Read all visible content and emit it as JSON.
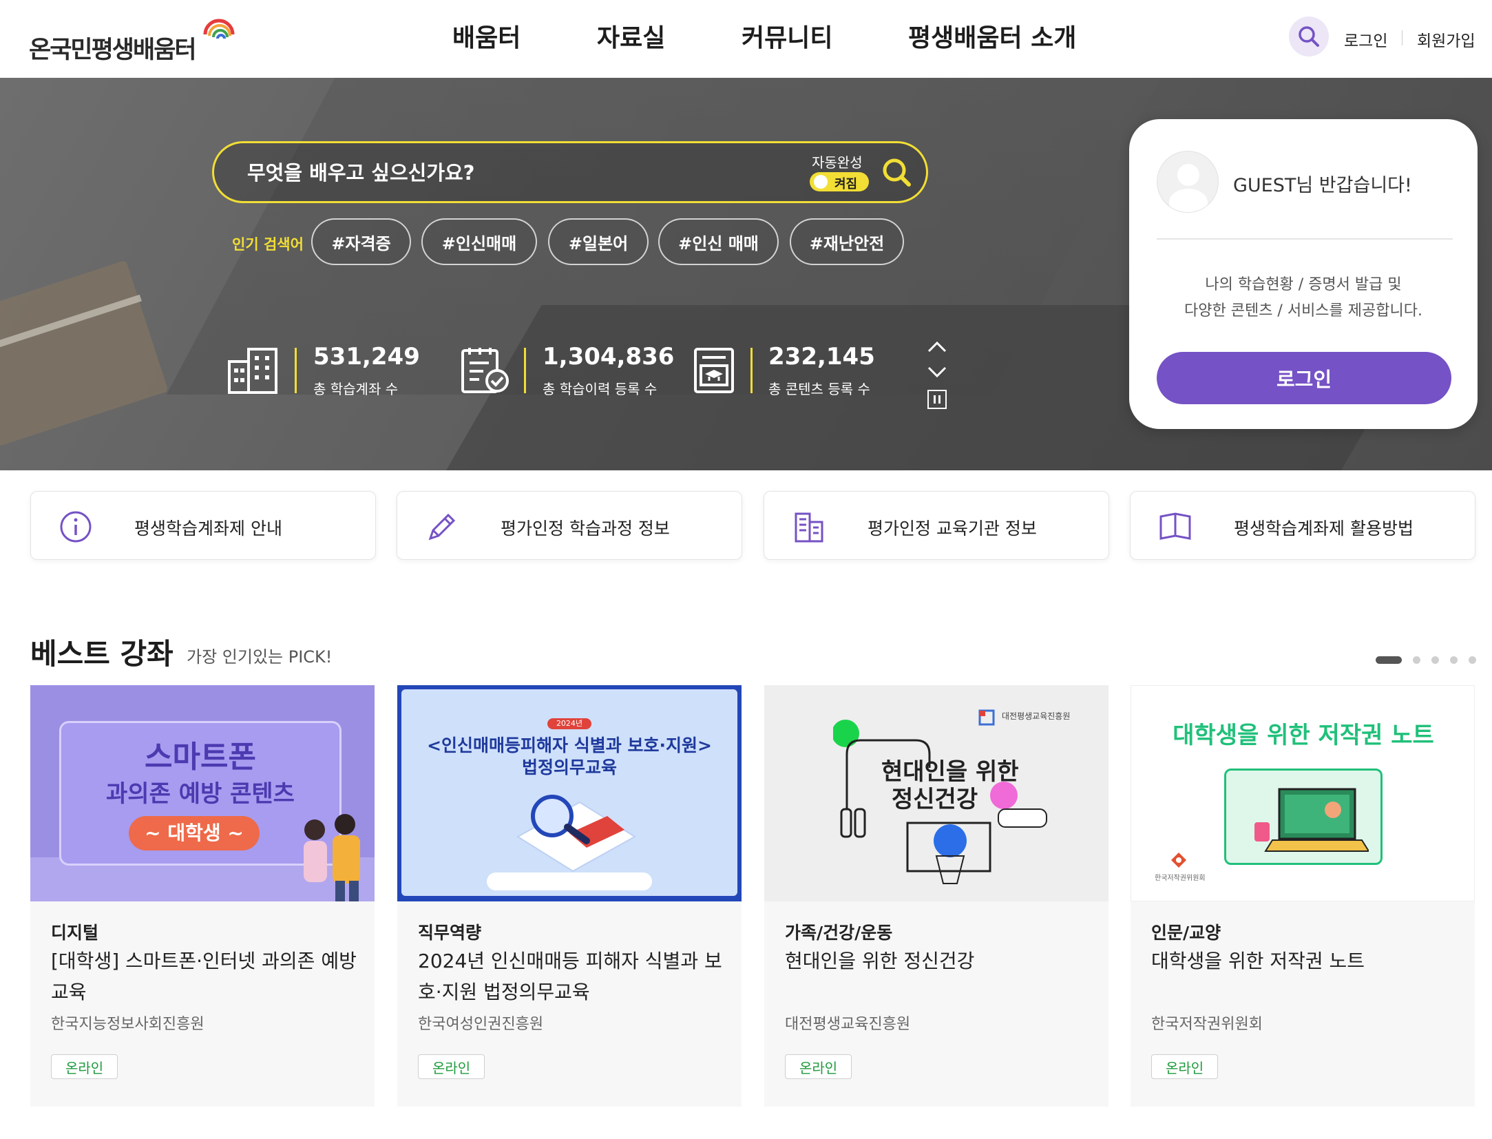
{
  "header": {
    "logo_text": "온국민평생배움터",
    "nav": [
      "배움터",
      "자료실",
      "커뮤니티",
      "평생배움터 소개"
    ],
    "login_link": "로그인",
    "signup_link": "회원가입"
  },
  "hero": {
    "search_placeholder": "무엇을 배우고 싶으신가요?",
    "autocomplete_label": "자동완성",
    "autocomplete_state": "켜짐",
    "popular_label": "인기 검색어",
    "tags": [
      "#자격증",
      "#인신매매",
      "#일본어",
      "#인신 매매",
      "#재난안전"
    ],
    "stats": [
      {
        "value": "531,249",
        "label": "총 학습계좌 수",
        "icon": "building-icon"
      },
      {
        "value": "1,304,836",
        "label": "총 학습이력 등록 수",
        "icon": "checklist-icon"
      },
      {
        "value": "232,145",
        "label": "총 콘텐츠 등록 수",
        "icon": "content-icon"
      }
    ]
  },
  "login_card": {
    "greeting": "GUEST님 반갑습니다!",
    "desc_line1": "나의 학습현황 / 증명서 발급 및",
    "desc_line2": "다양한 콘텐츠 / 서비스를 제공합니다.",
    "button": "로그인"
  },
  "quick_menu": [
    {
      "label": "평생학습계좌제 안내",
      "icon": "info-icon"
    },
    {
      "label": "평가인정 학습과정 정보",
      "icon": "pencil-icon"
    },
    {
      "label": "평가인정 교육기관 정보",
      "icon": "building-icon"
    },
    {
      "label": "평생학습계좌제 활용방법",
      "icon": "book-icon"
    }
  ],
  "best": {
    "title": "베스트 강좌",
    "subtitle": "가장 인기있는 PICK!",
    "courses": [
      {
        "category": "디지털",
        "title": "[대학생] 스마트폰·인터넷 과의존 예방 교육",
        "org": "한국지능정보사회진흥원",
        "badge": "온라인",
        "thumb": {
          "line1": "스마트폰",
          "line2": "과의존 예방 콘텐츠",
          "pill": "~ 대학생 ~"
        }
      },
      {
        "category": "직무역량",
        "title": "2024년 인신매매등 피해자 식별과 보호·지원 법정의무교육",
        "org": "한국여성인권진흥원",
        "badge": "온라인",
        "thumb": {
          "year": "2024년",
          "line1": "<인신매매등피해자 식별과 보호·지원>",
          "line2": "법정의무교육"
        }
      },
      {
        "category": "가족/건강/운동",
        "title": "현대인을 위한 정신건강",
        "org": "대전평생교육진흥원",
        "badge": "온라인",
        "thumb": {
          "line1": "현대인을 위한",
          "line2": "정신건강",
          "org": "대전평생교육진흥원"
        }
      },
      {
        "category": "인문/교양",
        "title": "대학생을 위한 저작권 노트",
        "org": "한국저작권위원회",
        "badge": "온라인",
        "thumb": {
          "line1": "대학생을 위한 저작권 노트",
          "org": "한국저작권위원회"
        }
      }
    ]
  }
}
